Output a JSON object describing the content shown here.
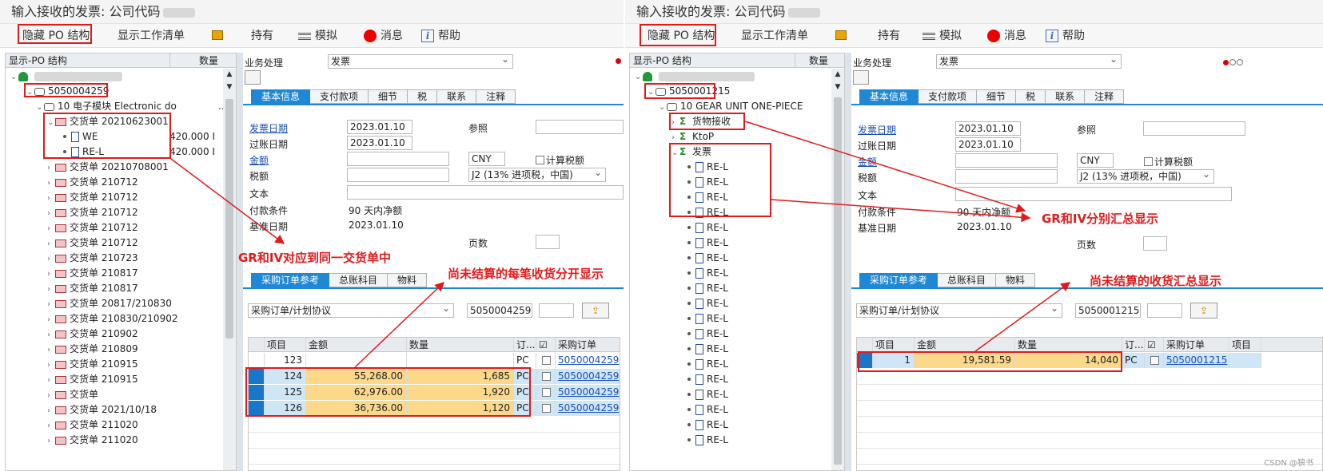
{
  "left": {
    "title": "输入接收的发票: 公司代码",
    "toolbar": {
      "hide_po": "隐藏 PO 结构",
      "worklist": "显示工作清单",
      "hold": "持有",
      "simulate": "模拟",
      "messages": "消息",
      "help": "帮助"
    },
    "tree": {
      "header_struct": "显示-PO 结构",
      "header_qty": "数量",
      "po": "5050004259",
      "item": "10 电子模块 Electronic do",
      "item_suffix": "..",
      "rows": [
        {
          "label": "交货单 20210623001"
        },
        {
          "label": "WE",
          "qty": "420.000 I"
        },
        {
          "label": "RE-L",
          "qty": "420.000 I"
        },
        {
          "label": "交货单 20210708001"
        },
        {
          "label": "交货单 210712"
        },
        {
          "label": "交货单 210712"
        },
        {
          "label": "交货单 210712"
        },
        {
          "label": "交货单 210712"
        },
        {
          "label": "交货单 210712"
        },
        {
          "label": "交货单 210723"
        },
        {
          "label": "交货单 210817"
        },
        {
          "label": "交货单 210817"
        },
        {
          "label": "交货单 20817/210830"
        },
        {
          "label": "交货单 210830/210902"
        },
        {
          "label": "交货单 210902"
        },
        {
          "label": "交货单 210809"
        },
        {
          "label": "交货单 210915"
        },
        {
          "label": "交货单 210915"
        },
        {
          "label": "交货单"
        },
        {
          "label": "交货单 2021/10/18"
        },
        {
          "label": "交货单 211020"
        },
        {
          "label": "交货单 211020"
        }
      ]
    },
    "form": {
      "biz_label": "业务处理",
      "biz_value": "发票",
      "tabs": [
        "基本信息",
        "支付款项",
        "细节",
        "税",
        "联系",
        "注释"
      ],
      "invoice_date_label": "发票日期",
      "invoice_date": "2023.01.10",
      "ref_label": "参照",
      "posting_date_label": "过账日期",
      "posting_date": "2023.01.10",
      "amount_label": "金额",
      "currency": "CNY",
      "calc_tax": "计算税额",
      "tax_label": "税额",
      "tax_code": "J2 (13% 进项税，中国)",
      "text_label": "文本",
      "payterm_label": "付款条件",
      "payterm": "90 天内净额",
      "basedate_label": "基准日期",
      "basedate": "2023.01.10",
      "pages_label": "页数",
      "ref_tabs": [
        "采购订单参考",
        "总账科目",
        "物料"
      ],
      "ref_type": "采购订单/计划协议",
      "ref_po": "5050004259"
    },
    "grid": {
      "headers": [
        "项目",
        "金额",
        "数量",
        "订...",
        "采购订单"
      ],
      "rows": [
        {
          "item": "123",
          "amount": "",
          "qty": "",
          "unit": "PC",
          "po": "5050004259"
        },
        {
          "item": "124",
          "amount": "55,268.00",
          "qty": "1,685",
          "unit": "PC",
          "po": "5050004259"
        },
        {
          "item": "125",
          "amount": "62,976.00",
          "qty": "1,920",
          "unit": "PC",
          "po": "5050004259"
        },
        {
          "item": "126",
          "amount": "36,736.00",
          "qty": "1,120",
          "unit": "PC",
          "po": "5050004259"
        }
      ]
    },
    "annotations": {
      "a1": "GR和IV对应到同一交货单中",
      "a2": "尚未结算的每笔收货分开显示"
    }
  },
  "right": {
    "title": "输入接收的发票: 公司代码",
    "toolbar": {
      "hide_po": "隐藏 PO 结构",
      "worklist": "显示工作清单",
      "hold": "持有",
      "simulate": "模拟",
      "messages": "消息",
      "help": "帮助"
    },
    "tree": {
      "header_struct": "显示-PO 结构",
      "header_qty": "数量",
      "po": "5050001215",
      "item": "10 GEAR UNIT ONE-PIECE",
      "gr": "货物接收",
      "ktop": "KtoP",
      "inv": "发票",
      "rel": "RE-L"
    },
    "form": {
      "biz_label": "业务处理",
      "biz_value": "发票",
      "tabs": [
        "基本信息",
        "支付款项",
        "细节",
        "税",
        "联系",
        "注释"
      ],
      "invoice_date_label": "发票日期",
      "invoice_date": "2023.01.10",
      "ref_label": "参照",
      "posting_date_label": "过账日期",
      "posting_date": "2023.01.10",
      "amount_label": "金额",
      "currency": "CNY",
      "calc_tax": "计算税额",
      "tax_label": "税额",
      "tax_code": "J2 (13% 进项税，中国)",
      "text_label": "文本",
      "payterm_label": "付款条件",
      "payterm": "90 天内净额",
      "basedate_label": "基准日期",
      "basedate": "2023.01.10",
      "pages_label": "页数",
      "ref_tabs": [
        "采购订单参考",
        "总账科目",
        "物料"
      ],
      "ref_type": "采购订单/计划协议",
      "ref_po": "5050001215"
    },
    "grid": {
      "headers": [
        "项目",
        "金额",
        "数量",
        "订...",
        "采购订单",
        "项目"
      ],
      "rows": [
        {
          "item": "1",
          "amount": "19,581.59",
          "qty": "14,040",
          "unit": "PC",
          "po": "5050001215"
        }
      ]
    },
    "annotations": {
      "a1": "GR和IV分别汇总显示",
      "a2": "尚未结算的收货汇总显示"
    }
  },
  "watermark": "CSDN @狼书"
}
